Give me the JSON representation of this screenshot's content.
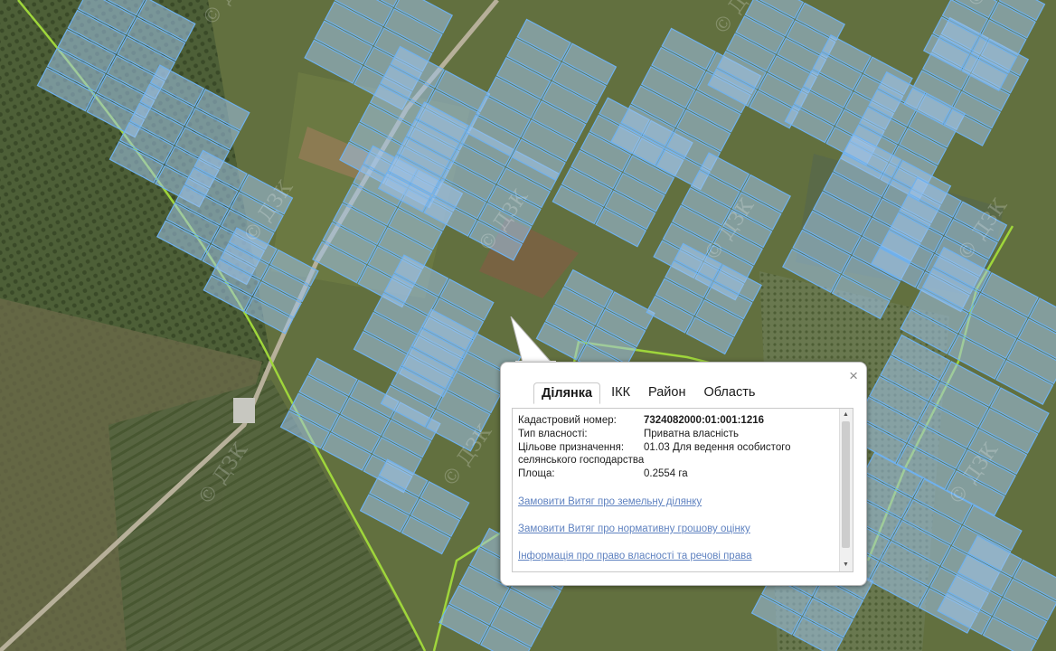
{
  "watermark": "© ДЗК",
  "colors": {
    "parcel_fill": "#9fc3ea",
    "parcel_stroke": "#6fb1ee",
    "boundary": "#9fd63b",
    "link": "#5f82c0"
  },
  "popup": {
    "close_label": "×",
    "tabs": [
      {
        "label": "Ділянка",
        "active": true
      },
      {
        "label": "ІКК",
        "active": false
      },
      {
        "label": "Район",
        "active": false
      },
      {
        "label": "Область",
        "active": false
      }
    ],
    "fields": {
      "cadastral_label": "Кадастровий номер:",
      "cadastral_value": "7324082000:01:001:1216",
      "ownership_label": "Тип власності:",
      "ownership_value": "Приватна власність",
      "purpose_label": "Цільове призначення:",
      "purpose_value": "01.03 Для ведення особистого",
      "purpose_value_cont": "селянського господарства",
      "area_label": "Площа:",
      "area_value": "0.2554 га"
    },
    "links": [
      "Замовити Витяг про земельну ділянку",
      "Замовити Витяг про нормативну грошову оцінку",
      "Інформація про право власності та речові права"
    ],
    "scroll_up": "▲",
    "scroll_down": "▼"
  }
}
